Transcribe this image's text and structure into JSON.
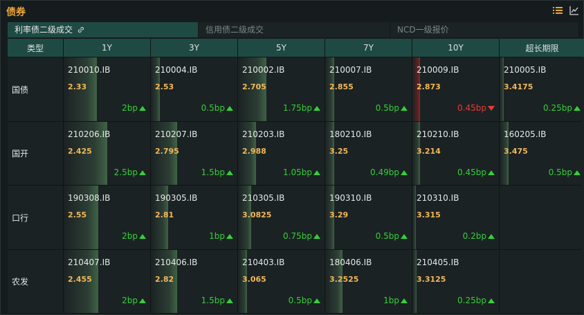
{
  "header": {
    "title": "债券",
    "icons": [
      "list-icon",
      "line-chart-icon"
    ]
  },
  "tabs": [
    {
      "label": "利率债二级成交",
      "active": true
    },
    {
      "label": "信用债二级成交",
      "active": false
    },
    {
      "label": "NCD一级报价",
      "active": false
    }
  ],
  "table": {
    "type_header": "类型",
    "columns": [
      "1Y",
      "3Y",
      "5Y",
      "7Y",
      "10Y",
      "超长期限"
    ],
    "rows": [
      {
        "label": "国债",
        "cells": [
          {
            "code": "210010.IB",
            "yield": "2.33",
            "change": "2bp",
            "direction": "up",
            "level": 0.38
          },
          {
            "code": "210004.IB",
            "yield": "2.53",
            "change": "0.5bp",
            "direction": "up",
            "level": 0.1
          },
          {
            "code": "210002.IB",
            "yield": "2.705",
            "change": "1.75bp",
            "direction": "up",
            "level": 0.33
          },
          {
            "code": "210007.IB",
            "yield": "2.855",
            "change": "0.5bp",
            "direction": "up",
            "level": 0.1
          },
          {
            "code": "210009.IB",
            "yield": "2.873",
            "change": "0.45bp",
            "direction": "down",
            "level": 0.09
          },
          {
            "code": "210005.IB",
            "yield": "3.4175",
            "change": "0.25bp",
            "direction": "up",
            "level": 0.05
          }
        ]
      },
      {
        "label": "国开",
        "cells": [
          {
            "code": "210206.IB",
            "yield": "2.425",
            "change": "2.5bp",
            "direction": "up",
            "level": 0.5
          },
          {
            "code": "210207.IB",
            "yield": "2.795",
            "change": "1.5bp",
            "direction": "up",
            "level": 0.3
          },
          {
            "code": "210203.IB",
            "yield": "2.988",
            "change": "1.05bp",
            "direction": "up",
            "level": 0.21
          },
          {
            "code": "180210.IB",
            "yield": "3.25",
            "change": "0.49bp",
            "direction": "up",
            "level": 0.1
          },
          {
            "code": "210210.IB",
            "yield": "3.214",
            "change": "0.45bp",
            "direction": "up",
            "level": 0.09
          },
          {
            "code": "160205.IB",
            "yield": "3.475",
            "change": "0.5bp",
            "direction": "up",
            "level": 0.1
          }
        ]
      },
      {
        "label": "口行",
        "cells": [
          {
            "code": "190308.IB",
            "yield": "2.55",
            "change": "2bp",
            "direction": "up",
            "level": 0.4
          },
          {
            "code": "190305.IB",
            "yield": "2.81",
            "change": "1bp",
            "direction": "up",
            "level": 0.2
          },
          {
            "code": "210305.IB",
            "yield": "3.0825",
            "change": "0.75bp",
            "direction": "up",
            "level": 0.15
          },
          {
            "code": "190310.IB",
            "yield": "3.29",
            "change": "0.5bp",
            "direction": "up",
            "level": 0.1
          },
          {
            "code": "210310.IB",
            "yield": "3.315",
            "change": "0.2bp",
            "direction": "up",
            "level": 0.04
          },
          null
        ]
      },
      {
        "label": "农发",
        "cells": [
          {
            "code": "210407.IB",
            "yield": "2.455",
            "change": "2bp",
            "direction": "up",
            "level": 0.4
          },
          {
            "code": "210406.IB",
            "yield": "2.82",
            "change": "1.5bp",
            "direction": "up",
            "level": 0.3
          },
          {
            "code": "210403.IB",
            "yield": "3.065",
            "change": "0.5bp",
            "direction": "up",
            "level": 0.1
          },
          {
            "code": "180406.IB",
            "yield": "3.2525",
            "change": "1bp",
            "direction": "up",
            "level": 0.2
          },
          {
            "code": "210405.IB",
            "yield": "3.3125",
            "change": "0.25bp",
            "direction": "up",
            "level": 0.05
          },
          null
        ]
      }
    ]
  },
  "colors": {
    "accent": "#f0a63a",
    "header_bg": "#1f4a43",
    "up": "#35d03a",
    "down": "#e83a3a",
    "yield": "#f2b85b"
  }
}
